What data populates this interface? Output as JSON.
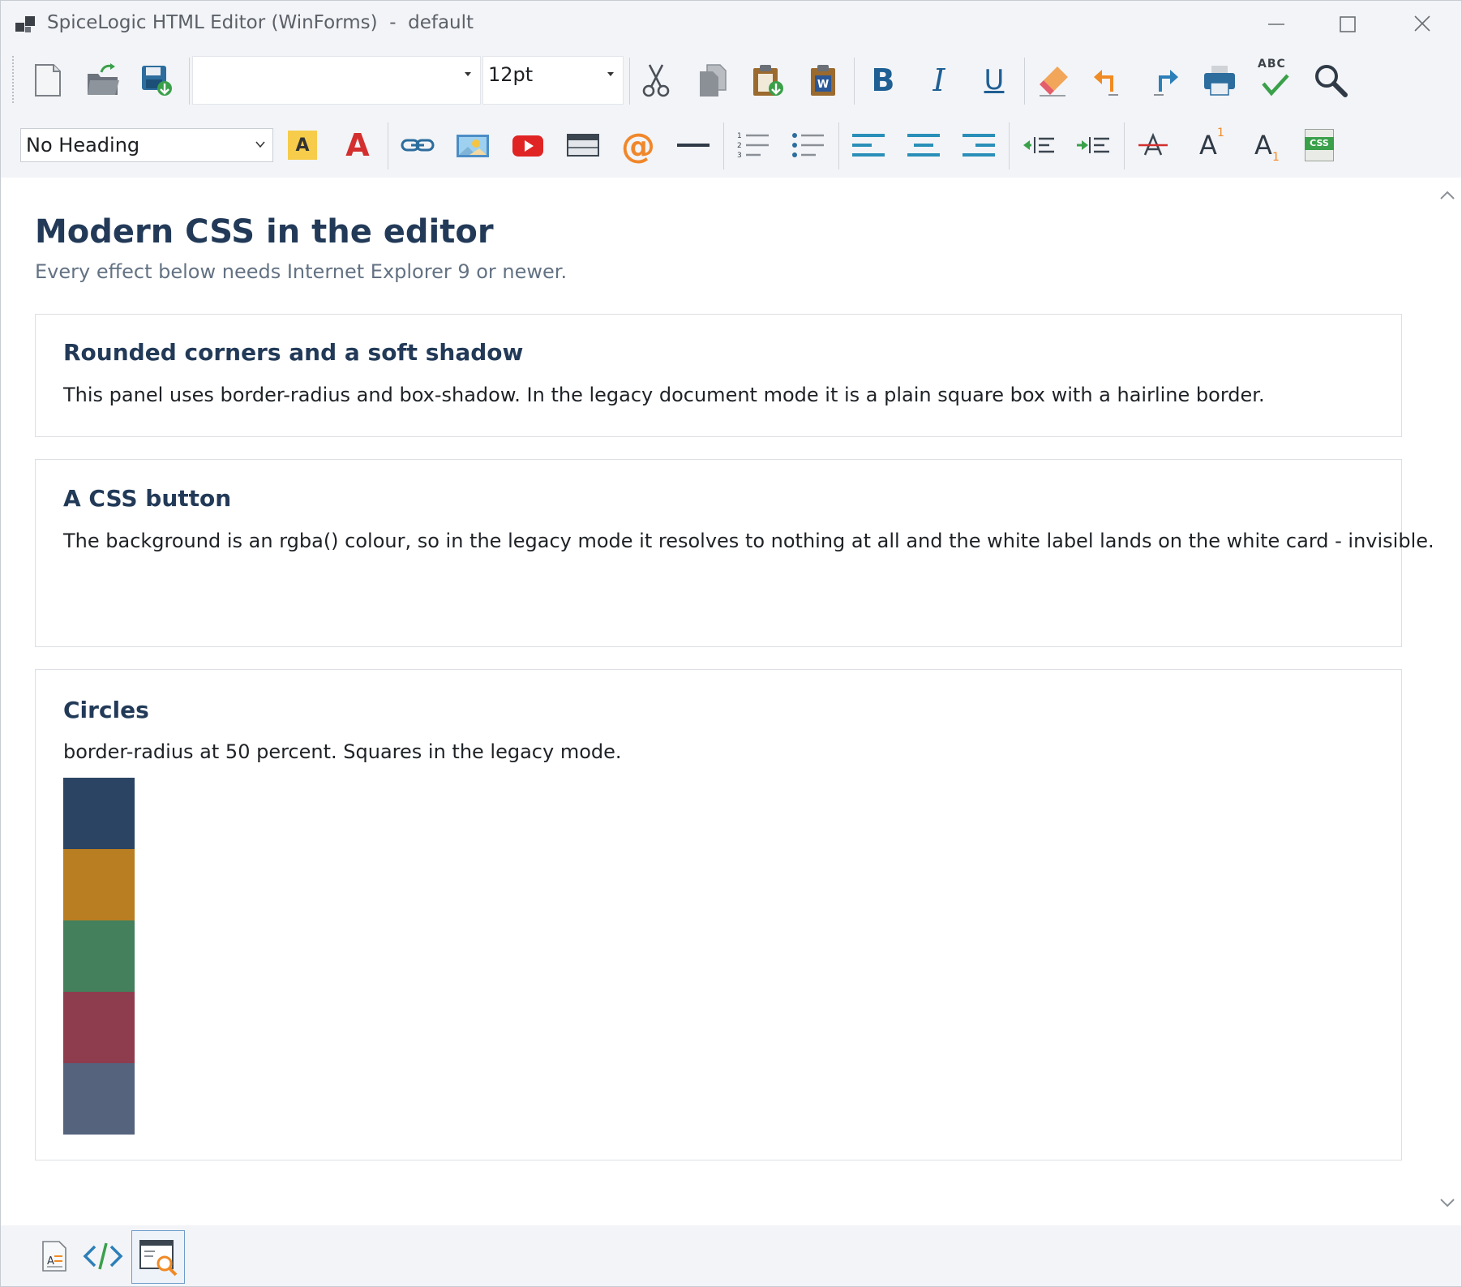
{
  "window": {
    "title": "SpiceLogic HTML Editor (WinForms)  -  default",
    "icons": [
      "app-icon",
      "minimize-icon",
      "maximize-icon",
      "close-icon"
    ]
  },
  "toolbar1": {
    "font_family_value": "",
    "font_size_value": "12pt",
    "bold_label": "B",
    "italic_label": "I",
    "underline_label": "U",
    "spellcheck_label": "ABC",
    "icons": [
      "new-document-icon",
      "open-folder-icon",
      "save-icon",
      "cut-icon",
      "copy-icon",
      "paste-icon",
      "paste-from-word-icon",
      "bold-icon",
      "italic-icon",
      "underline-icon",
      "eraser-icon",
      "undo-icon",
      "redo-icon",
      "print-icon",
      "spellcheck-icon",
      "search-icon"
    ]
  },
  "toolbar2": {
    "heading_value": "No Heading",
    "highlight_label": "A",
    "font_color_label": "A",
    "email_label": "@",
    "superscript_label": "A",
    "superscript_mark": "1",
    "subscript_label": "A",
    "subscript_mark": "1",
    "css_label": "CSS",
    "icons": [
      "highlight-icon",
      "font-color-icon",
      "link-icon",
      "image-icon",
      "youtube-icon",
      "table-icon",
      "email-icon",
      "horizontal-rule-icon",
      "numbered-list-icon",
      "bullet-list-icon",
      "align-left-icon",
      "align-center-icon",
      "align-right-icon",
      "outdent-icon",
      "indent-icon",
      "strikethrough-icon",
      "superscript-icon",
      "subscript-icon",
      "css-icon"
    ]
  },
  "document": {
    "title": "Modern CSS in the editor",
    "subtitle": "Every effect below needs Internet Explorer 9 or newer.",
    "cards": [
      {
        "heading": "Rounded corners and a soft shadow",
        "text": "This panel uses border-radius and box-shadow. In the legacy document mode it is a plain square box with a hairline border."
      },
      {
        "heading": "A CSS button",
        "text": "The background is an rgba() colour, so in the legacy mode it resolves to nothing at all and the white label lands on the white card - invisible."
      },
      {
        "heading": "Circles",
        "text": "border-radius at 50 percent. Squares in the legacy mode."
      }
    ],
    "swatches": [
      "#2b4463",
      "#b97d22",
      "#43805b",
      "#8e3d4e",
      "#55637d"
    ]
  },
  "bottom_tabs": {
    "icons": [
      "design-view-icon",
      "source-view-icon",
      "preview-icon"
    ],
    "active": "preview"
  },
  "colors": {
    "heading": "#223a58",
    "chrome": "#f3f4f7",
    "accent_blue": "#2c7fb8"
  }
}
